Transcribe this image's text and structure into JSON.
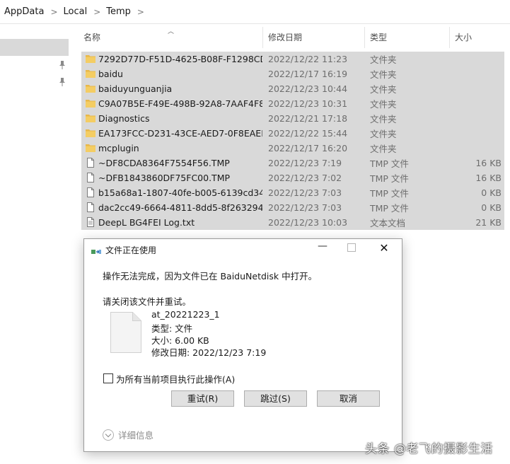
{
  "breadcrumb": [
    "AppData",
    "Local",
    "Temp"
  ],
  "columns": {
    "name": "名称",
    "date": "修改日期",
    "type": "类型",
    "size": "大小"
  },
  "files": [
    {
      "name": "7292D77D-F51D-4625-B08F-F1298CD...",
      "date": "2022/12/22 11:23",
      "type": "文件夹",
      "size": "",
      "icon": "folder-icon"
    },
    {
      "name": "baidu",
      "date": "2022/12/17 16:19",
      "type": "文件夹",
      "size": "",
      "icon": "folder-icon"
    },
    {
      "name": "baiduyunguanjia",
      "date": "2022/12/23 10:44",
      "type": "文件夹",
      "size": "",
      "icon": "folder-icon"
    },
    {
      "name": "C9A07B5E-F49E-498B-92A8-7AAF4F8...",
      "date": "2022/12/23 10:31",
      "type": "文件夹",
      "size": "",
      "icon": "folder-icon"
    },
    {
      "name": "Diagnostics",
      "date": "2022/12/21 17:18",
      "type": "文件夹",
      "size": "",
      "icon": "folder-icon"
    },
    {
      "name": "EA173FCC-D231-43CE-AED7-0F8EAEE...",
      "date": "2022/12/22 15:44",
      "type": "文件夹",
      "size": "",
      "icon": "folder-icon"
    },
    {
      "name": "mcplugin",
      "date": "2022/12/17 16:20",
      "type": "文件夹",
      "size": "",
      "icon": "folder-icon"
    },
    {
      "name": "~DF8CDA8364F7554F56.TMP",
      "date": "2022/12/23 7:19",
      "type": "TMP 文件",
      "size": "16 KB",
      "icon": "file-icon"
    },
    {
      "name": "~DFB1843860DF75FC00.TMP",
      "date": "2022/12/23 7:02",
      "type": "TMP 文件",
      "size": "16 KB",
      "icon": "file-icon"
    },
    {
      "name": "b15a68a1-1807-40fe-b005-6139cd34...",
      "date": "2022/12/23 7:03",
      "type": "TMP 文件",
      "size": "0 KB",
      "icon": "file-icon"
    },
    {
      "name": "dac2cc49-6664-4811-8dd5-8f263294...",
      "date": "2022/12/23 7:03",
      "type": "TMP 文件",
      "size": "0 KB",
      "icon": "file-icon"
    },
    {
      "name": "DeepL BG4FEI Log.txt",
      "date": "2022/12/23 10:03",
      "type": "文本文档",
      "size": "21 KB",
      "icon": "text-file-icon"
    }
  ],
  "dialog": {
    "title": "文件正在使用",
    "message": "操作无法完成，因为文件已在 BaiduNetdisk 中打开。",
    "hint": "请关闭该文件并重试。",
    "file_name": "at_20221223_1",
    "file_type": "类型: 文件",
    "file_size": "大小: 6.00 KB",
    "file_modified": "修改日期: 2022/12/23 7:19",
    "checkbox_label": "为所有当前项目执行此操作(A)",
    "checkbox_checked": false,
    "retry_label": "重试(R)",
    "skip_label": "跳过(S)",
    "cancel_label": "取消",
    "details_label": "详细信息"
  },
  "watermark": "头条 @老飞的摄影生活",
  "colors": {
    "selection": "#d9d9d9",
    "folder": "#f2c94c",
    "secondary_text": "#6d6d6d"
  }
}
